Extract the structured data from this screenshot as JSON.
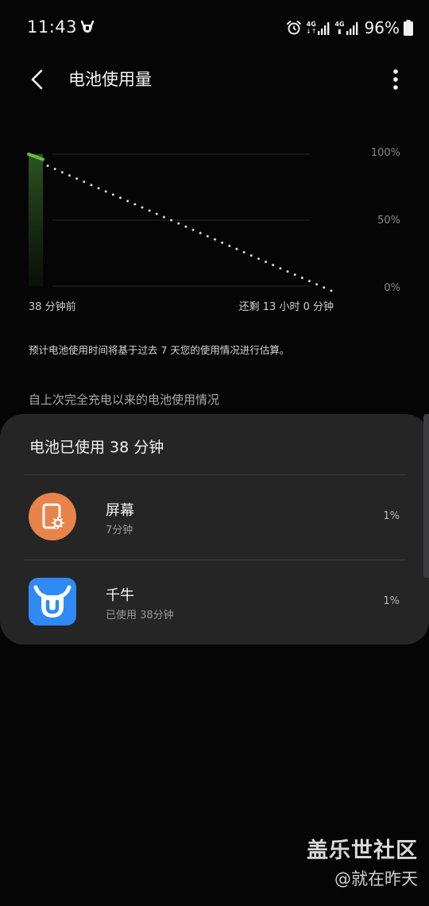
{
  "status_bar": {
    "time": "11:43",
    "network_1": "4G",
    "network_2": "4G",
    "battery_percent": "96%",
    "icons": [
      "app-notification-icon",
      "alarm-icon",
      "data-arrows-icon",
      "signal-icon",
      "signal-icon",
      "battery-icon"
    ]
  },
  "app_bar": {
    "title": "电池使用量",
    "back_icon": "chevron-left-icon",
    "more_icon": "more-vertical-icon"
  },
  "chart_data": {
    "type": "line",
    "ylim": [
      0,
      100
    ],
    "y_ticks": [
      "100%",
      "50%",
      "0%"
    ],
    "x_start_label": "38 分钟前",
    "x_end_label": "还剩 13 小时 0 分钟",
    "series": [
      {
        "values": [
          {
            "minutes": -38,
            "percent": 100
          },
          {
            "minutes": 0,
            "percent": 96
          }
        ],
        "color": "#66bb44"
      },
      {
        "values": [
          {
            "minutes": 0,
            "percent": 96
          },
          {
            "minutes": 780,
            "percent": 0
          }
        ],
        "style": "dotted",
        "color": "#d8d8d8"
      }
    ],
    "grid": true
  },
  "estimate_note": "预计电池使用时间将基于过去 7 天您的使用情况进行估算。",
  "section_header": "自上次完全充电以来的电池使用情况",
  "usage_card": {
    "title": "电池已使用 38 分钟",
    "items": [
      {
        "name": "屏幕",
        "sub": "7分钟",
        "percent": "1%",
        "icon": "screen-settings-icon",
        "icon_color": "#e8834a"
      },
      {
        "name": "千牛",
        "sub": "已使用 38分钟",
        "percent": "1%",
        "icon": "qianniu-app-icon",
        "icon_color": "#2f8af5"
      }
    ]
  },
  "watermark": {
    "title": "盖乐世社区",
    "handle": "@就在昨天"
  }
}
